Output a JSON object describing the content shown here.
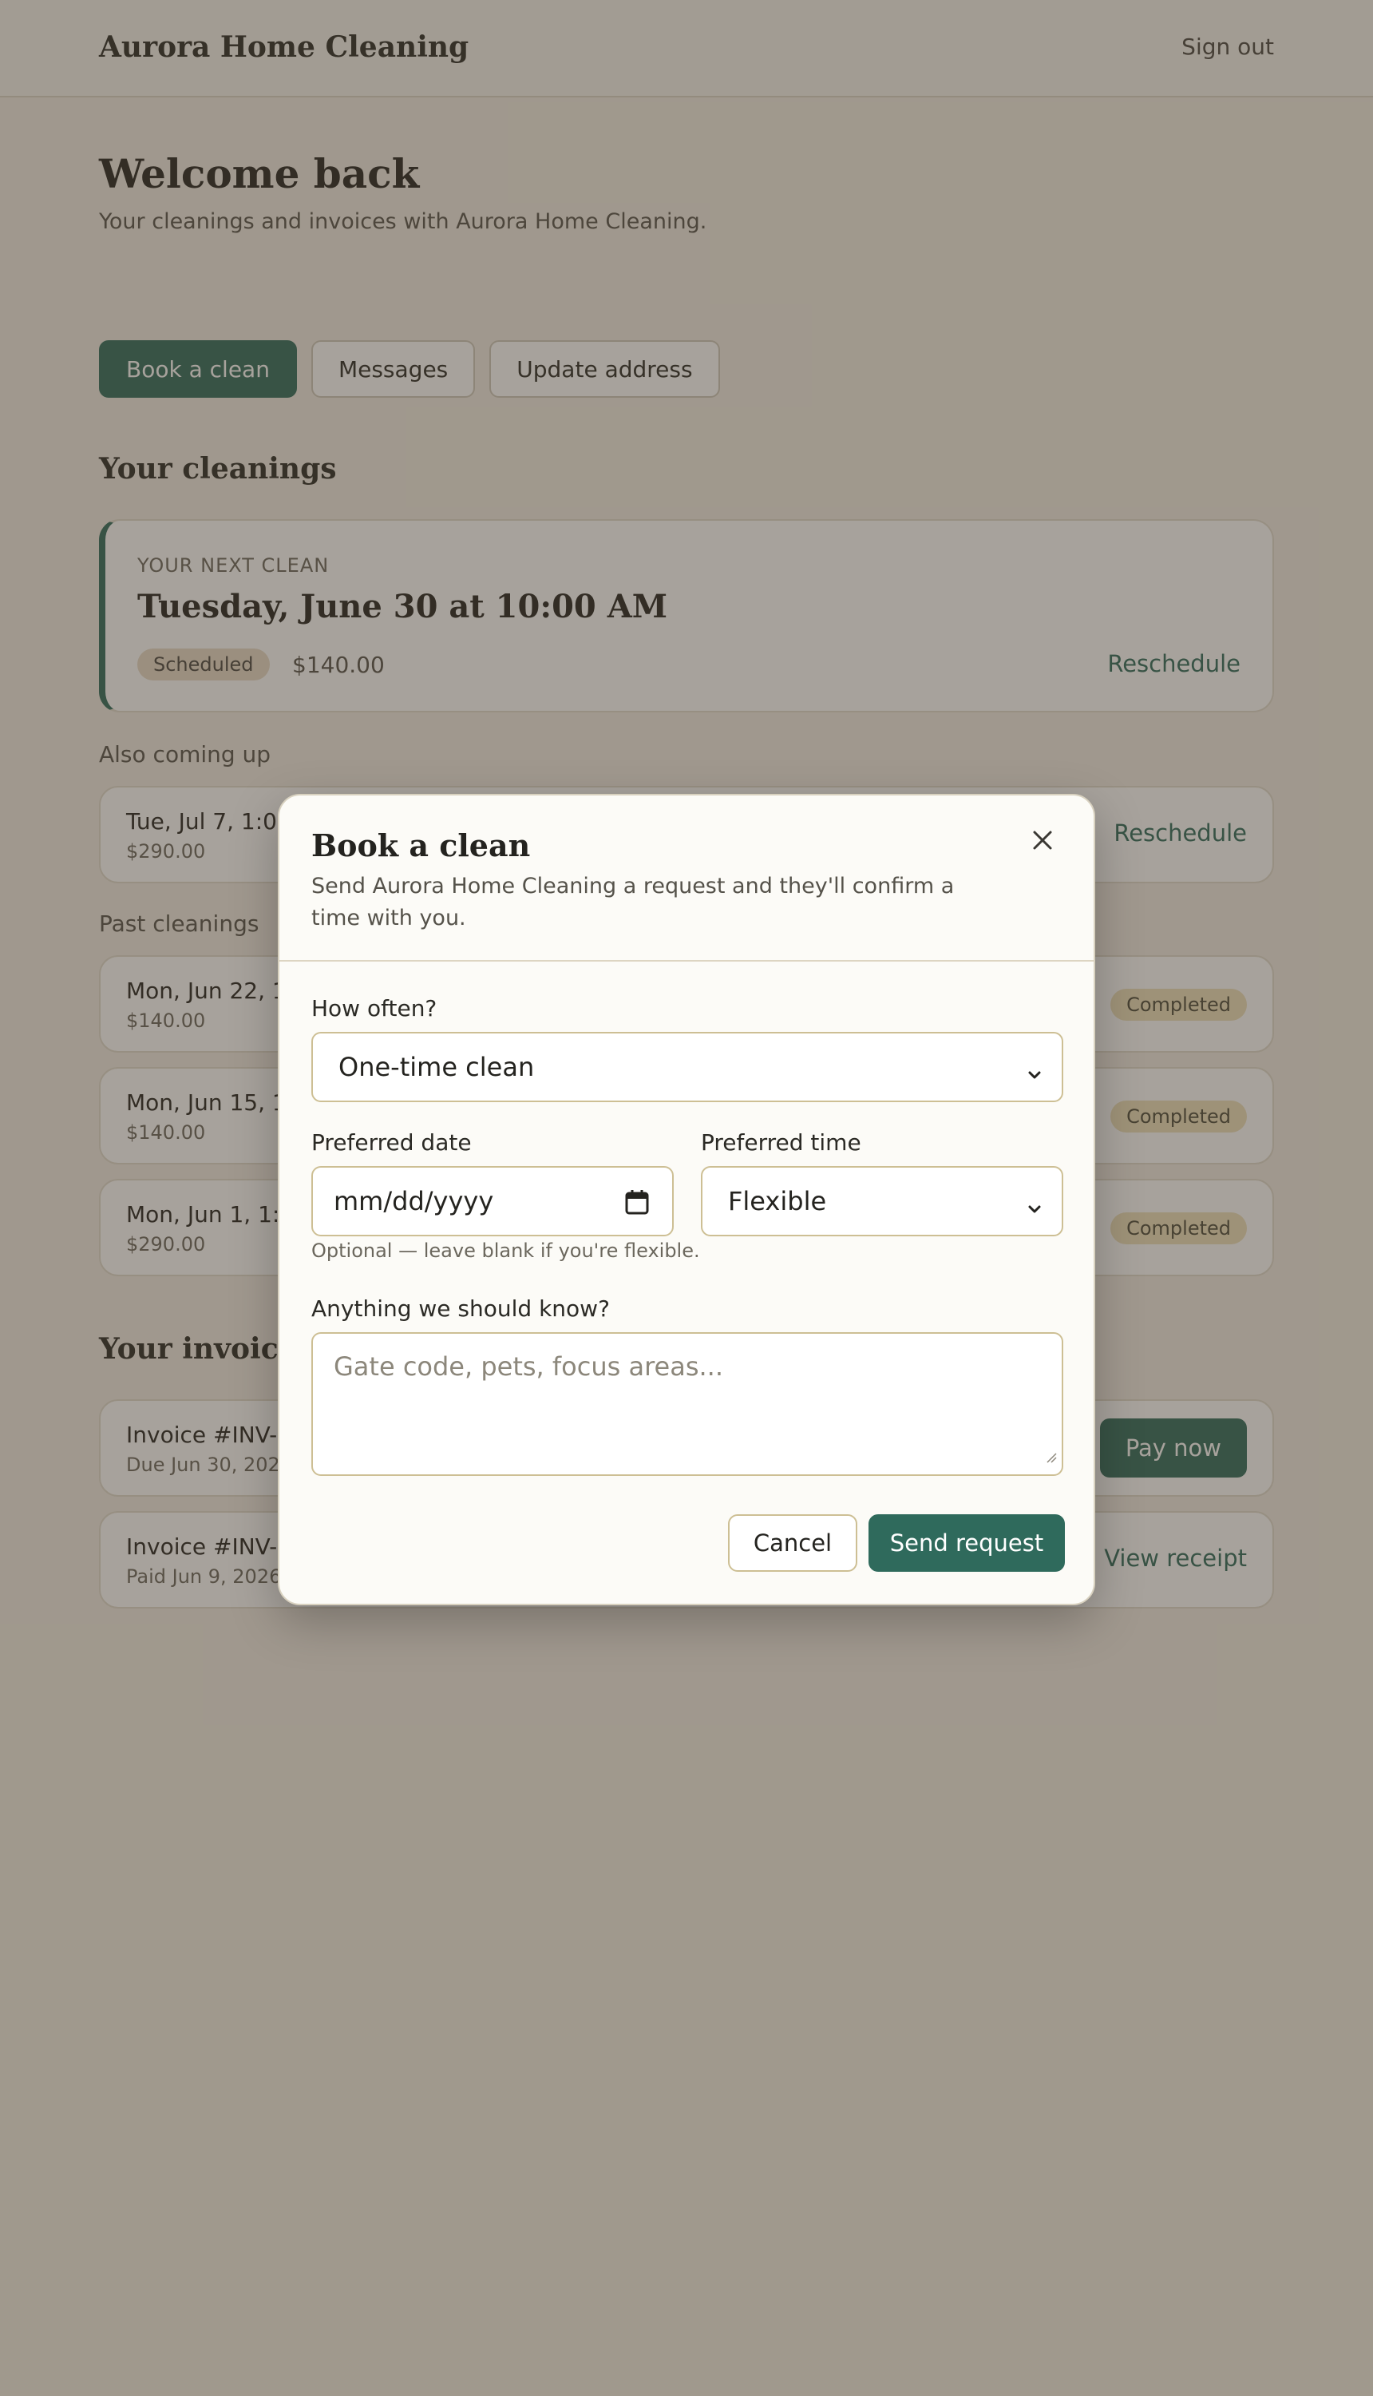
{
  "header": {
    "brand": "Aurora Home Cleaning",
    "sign_out": "Sign out"
  },
  "welcome": {
    "title": "Welcome back",
    "subtitle": "Your cleanings and invoices with Aurora Home Cleaning."
  },
  "actions": {
    "book": "Book a clean",
    "messages": "Messages",
    "update_address": "Update address"
  },
  "cleanings": {
    "title": "Your cleanings",
    "next": {
      "eyebrow": "YOUR NEXT CLEAN",
      "date": "Tuesday, June 30 at 10:00 AM",
      "status": "Scheduled",
      "price": "$140.00",
      "action": "Reschedule"
    },
    "upcoming_label": "Also coming up",
    "upcoming": [
      {
        "date": "Tue, Jul 7, 1:00",
        "price": "$290.00",
        "action": "Reschedule"
      }
    ],
    "past_label": "Past cleanings",
    "past": [
      {
        "date": "Mon, Jun 22, 10",
        "price": "$140.00",
        "status": "Completed"
      },
      {
        "date": "Mon, Jun 15, 10",
        "price": "$140.00",
        "status": "Completed"
      },
      {
        "date": "Mon, Jun 1, 1:00",
        "price": "$290.00",
        "status": "Completed"
      }
    ]
  },
  "invoices": {
    "title": "Your invoices",
    "items": [
      {
        "number": "Invoice #INV-1",
        "date": "Due Jun 30, 2026",
        "action": "Pay now"
      },
      {
        "number": "Invoice #INV-1",
        "date": "Paid Jun 9, 2026",
        "action": "View receipt"
      }
    ]
  },
  "modal": {
    "title": "Book a clean",
    "description": "Send Aurora Home Cleaning a request and they'll confirm a time with you.",
    "frequency_label": "How often?",
    "frequency_value": "One-time clean",
    "date_label": "Preferred date",
    "date_placeholder": "mm/dd/yyyy",
    "date_hint": "Optional — leave blank if you're flexible.",
    "time_label": "Preferred time",
    "time_value": "Flexible",
    "notes_label": "Anything we should know?",
    "notes_placeholder": "Gate code, pets, focus areas...",
    "cancel": "Cancel",
    "send": "Send request"
  },
  "icons": {
    "close": "close-icon",
    "chevron": "chevron-down-icon",
    "calendar": "calendar-icon"
  },
  "colors": {
    "accent": "#2f6a5c",
    "background": "#f2ede4",
    "overlay": "#443a2c"
  }
}
